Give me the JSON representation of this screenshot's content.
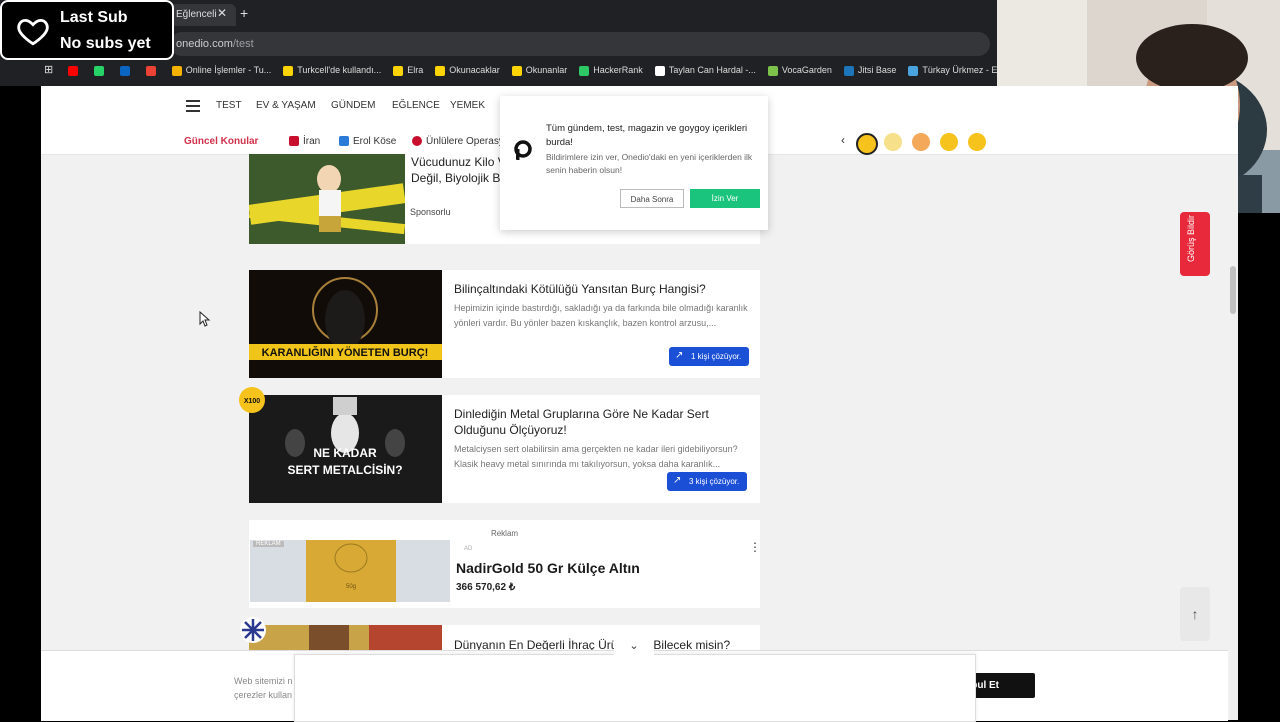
{
  "overlay": {
    "title": "Last Sub",
    "subtitle": "No subs yet"
  },
  "browser": {
    "tab_title": "Eğlenceli test",
    "url_host": "onedio.com",
    "url_path": "/test",
    "bookmarks": [
      {
        "label": "",
        "color": "#ff0000"
      },
      {
        "label": "",
        "color": "#25d366"
      },
      {
        "label": "",
        "color": "#0a66c2"
      },
      {
        "label": "",
        "color": "#ea4335"
      },
      {
        "label": "Online İşlemler - Tu...",
        "color": "#f4b400"
      },
      {
        "label": "Turkcell'de kullandı...",
        "color": "#ffd400"
      },
      {
        "label": "Elra",
        "color": "#ffd400"
      },
      {
        "label": "Okunacaklar",
        "color": "#ffd400"
      },
      {
        "label": "Okunanlar",
        "color": "#ffd400"
      },
      {
        "label": "HackerRank",
        "color": "#2ec866"
      },
      {
        "label": "Taylan Can Hardal -...",
        "color": "#ffffff"
      },
      {
        "label": "VocaGarden",
        "color": "#7cc24b"
      },
      {
        "label": "Jitsi Base",
        "color": "#1d76ba"
      },
      {
        "label": "Türkay Ürkmez - Ev...",
        "color": "#4aa3df"
      }
    ]
  },
  "nav": {
    "items": [
      "TEST",
      "EV & YAŞAM",
      "GÜNDEM",
      "EĞLENCE",
      "YEMEK"
    ]
  },
  "topics": {
    "label": "Güncel Konular",
    "items": [
      "İran",
      "Erol Köse",
      "Ünlülere Operasy"
    ]
  },
  "notification": {
    "title": "Tüm gündem, test, magazin ve goygoy içerikleri burda!",
    "body": "Bildirimlere izin ver, Onedio'daki en yeni içeriklerden ilk senin haberin olsun!",
    "later": "Daha Sonra",
    "allow": "İzin Ver"
  },
  "cards": [
    {
      "title": "Vücudunuz Kilo V... Değil, Biyolojik Bi...",
      "title_line1": "Vücudunuz Kilo V",
      "title_line2": "Değil, Biyolojik Bi",
      "tag": "Sponsorlu"
    },
    {
      "title": "Bilinçaltındaki Kötülüğü Yansıtan Burç Hangisi?",
      "desc": "Hepimizin içinde bastırdığı, sakladığı ya da farkında bile olmadığı karanlık yönleri vardır. Bu yönler bazen kıskançlık, bazen kontrol arzusu,...",
      "banner": "KARANLIĞINI YÖNETEN BURÇ!",
      "solving": "1 kişi çözüyor."
    },
    {
      "title": "Dinlediğin Metal Gruplarına Göre Ne Kadar Sert Olduğunu Ölçüyoruz!",
      "desc": "Metalciysen sert olabilirsin ama gerçekten ne kadar ileri gidebiliyorsun? Klasik heavy metal sınırında mı takılıyorsun, yoksa daha karanlık...",
      "banner_line1": "NE KADAR",
      "banner_line2": "SERT METALCİSİN?",
      "badge": "X100",
      "solving": "3 kişi çözüyor."
    },
    {
      "reklam": "Reklam",
      "ad_label": "AD",
      "thumb_tag": "REKLAM",
      "title": "NadirGold 50 Gr Külçe Altın",
      "price": "366 570,62 ₺"
    },
    {
      "title": "Dünyanın En Değerli İhraç Ürü... Bilecek misin?",
      "title_left": "Dünyanın En Değerli İhraç Ürü",
      "title_right": "Bilecek misin?"
    }
  ],
  "feedback": "Görüş Bildir",
  "cookie": {
    "text_line1": "Web sitemizi n",
    "text_line2": "çerezler kullan",
    "accept": "Kabul Et"
  },
  "colors": {
    "accent_red": "#d0314b",
    "solve_blue": "#1a4fd6",
    "allow_green": "#1bc47d",
    "feedback_red": "#e8293b"
  }
}
